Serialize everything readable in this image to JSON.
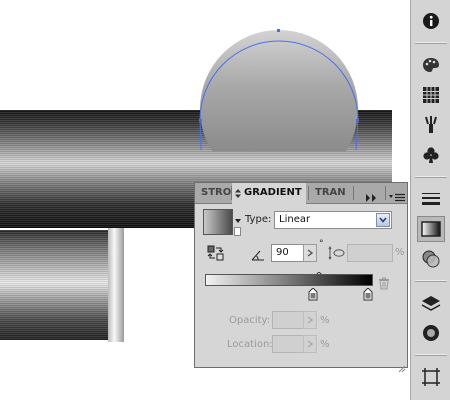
{
  "panel": {
    "tabs": [
      {
        "label": "STRO"
      },
      {
        "label": "GRADIENT"
      },
      {
        "label": "TRAN"
      }
    ],
    "type_label": "Type:",
    "type_value": "Linear",
    "angle_value": "90",
    "angle_unit": "°",
    "aspect_value": "",
    "aspect_unit": "%",
    "opacity_label": "Opacity:",
    "opacity_unit": "%",
    "location_label": "Location:",
    "location_unit": "%"
  },
  "gradient": {
    "start_color": "#f2f2f2",
    "end_color": "#000000",
    "midpoint_fraction": 0.68,
    "stops": [
      {
        "color": "#7a7a7a",
        "position": 0.64
      },
      {
        "color": "#7a7a7a",
        "position": 0.97
      }
    ]
  },
  "toolbar": {
    "icons": [
      "info-icon",
      "color-guide-palette-icon",
      "swatches-grid-icon",
      "brushes-icon",
      "symbols-club-icon",
      "stroke-lines-icon",
      "gradient-icon",
      "transparency-icon",
      "layers-icon",
      "appearance-icon",
      "artboards-icon"
    ],
    "selected": "gradient-icon"
  },
  "colors": {
    "selection": "#4a6ef0",
    "panel_bg": "#d6d6d6"
  }
}
